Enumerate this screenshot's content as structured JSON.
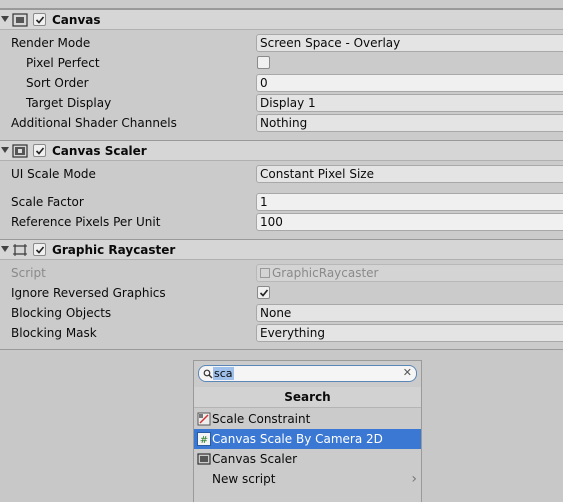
{
  "canvas": {
    "title": "Canvas",
    "enabled": true,
    "rows": [
      {
        "label": "Render Mode",
        "value": "Screen Space - Overlay"
      },
      {
        "label": "Pixel Perfect",
        "checked": false
      },
      {
        "label": "Sort Order",
        "value": "0"
      },
      {
        "label": "Target Display",
        "value": "Display 1"
      },
      {
        "label": "Additional Shader Channels",
        "value": "Nothing"
      }
    ]
  },
  "canvas_scaler": {
    "title": "Canvas Scaler",
    "enabled": true,
    "rows": [
      {
        "label": "UI Scale Mode",
        "value": "Constant Pixel Size"
      },
      {
        "label": "Scale Factor",
        "value": "1"
      },
      {
        "label": "Reference Pixels Per Unit",
        "value": "100"
      }
    ]
  },
  "graphic_raycaster": {
    "title": "Graphic Raycaster",
    "enabled": true,
    "rows": [
      {
        "label": "Script",
        "value": "GraphicRaycaster"
      },
      {
        "label": "Ignore Reversed Graphics",
        "checked": true
      },
      {
        "label": "Blocking Objects",
        "value": "None"
      },
      {
        "label": "Blocking Mask",
        "value": "Everything"
      }
    ]
  },
  "popup": {
    "search_value": "sca",
    "clear_glyph": "✕",
    "title": "Search",
    "items": [
      {
        "label": "Scale Constraint",
        "icon": "scale-constraint-icon"
      },
      {
        "label": "Canvas Scale By Camera 2D",
        "icon": "script-hash-icon",
        "selected": true
      },
      {
        "label": "Canvas Scaler",
        "icon": "canvas-scaler-icon"
      },
      {
        "label": "New script",
        "icon": "none",
        "submenu": true
      }
    ]
  },
  "colors": {
    "selection": "#3a78d4",
    "panel": "#cbcbcb",
    "header": "#d6d6d6"
  }
}
